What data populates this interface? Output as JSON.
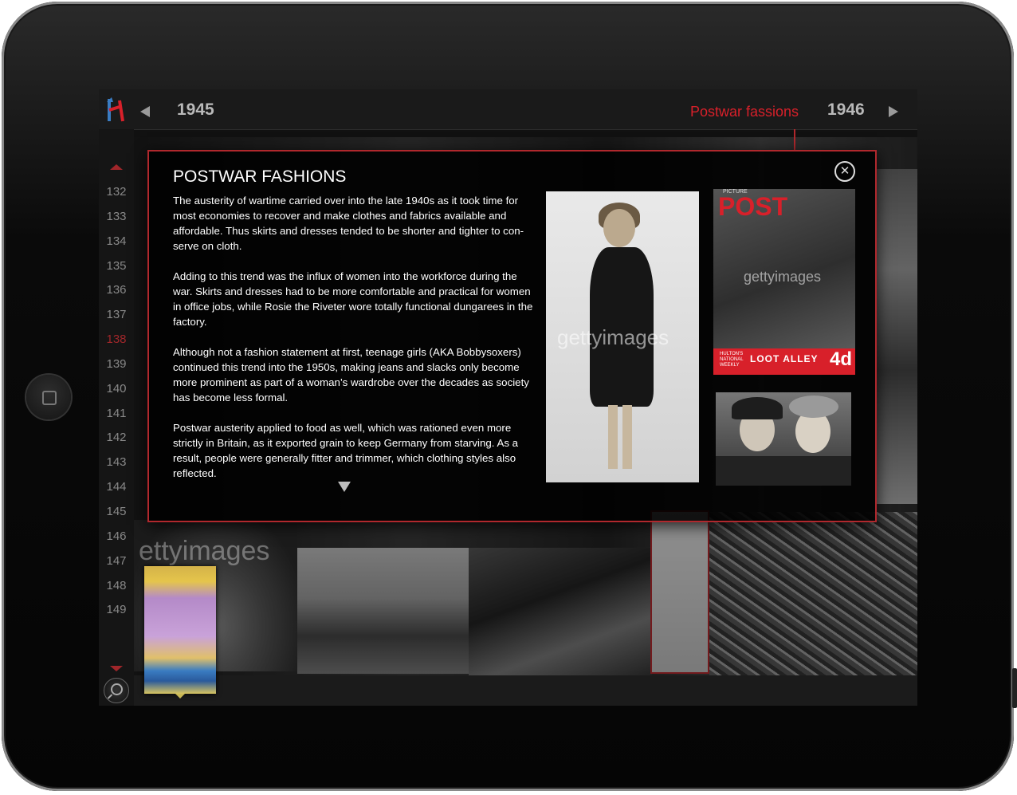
{
  "nav": {
    "prev_year": "1945",
    "next_year": "1946",
    "topic": "Postwar fassions"
  },
  "sidebar": {
    "pages": [
      "132",
      "133",
      "134",
      "135",
      "136",
      "137",
      "138",
      "139",
      "140",
      "141",
      "142",
      "143",
      "144",
      "145",
      "146",
      "147",
      "148",
      "149"
    ],
    "active_page": "138"
  },
  "collage": {
    "watermark": "ettyimages"
  },
  "modal": {
    "title": "POSTWAR FASHIONS",
    "paragraphs": [
      "The austerity of wartime carried over into the late 1940s as it took time for most economies to recover and make clothes and fabrics available and affordable.  Thus skirts and dresses tended to be shorter and tighter to con-serve on cloth.",
      "Adding to this trend was the influx of women into the workforce during the war.  Skirts and dresses had to be more comfortable and practical for women in office jobs, while Rosie the Riveter wore totally functional dungarees in the factory.",
      "Although not a fashion statement at first, teenage girls (AKA Bobbysoxers) continued this trend into the 1950s, making jeans and slacks only become more prominent as part of a woman’s wardrobe over the decades as society has become less formal.",
      "Postwar austerity applied to food as well, which was rationed even more strictly in Britain, as it exported grain to keep Germany from starving.  As a result, people were generally fitter and trimmer, which clothing styles also reflected."
    ],
    "photo1_watermark": "gettyimages",
    "magazine": {
      "small_header": "PICTURE",
      "title": "POST",
      "side_text": "HULTON'S NATIONAL WEEKLY",
      "headline": "LOOT ALLEY",
      "price": "4d",
      "watermark": "gettyimages"
    }
  },
  "colors": {
    "accent_red": "#d8202a",
    "border_red": "#b0282d"
  },
  "icons": {
    "logo": "h-logo-icon",
    "prev": "left-arrow-icon",
    "next": "right-arrow-icon",
    "close": "close-circle-icon",
    "search": "magnifier-icon"
  }
}
